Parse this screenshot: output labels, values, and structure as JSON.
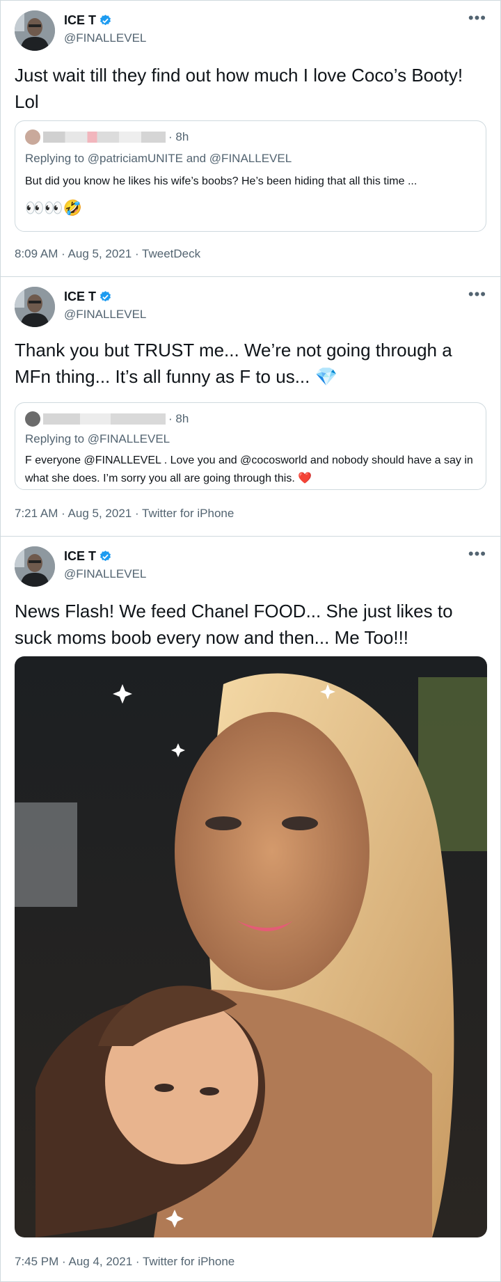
{
  "tweets": [
    {
      "author": "ICE T",
      "handle": "@FINALLEVEL",
      "text": "Just wait till they find out how much I love Coco’s Booty! Lol",
      "quote": {
        "time": "· 8h",
        "replying": "Replying to @patriciamUNITE and @FINALLEVEL",
        "body": "But did you know he likes his wife’s boobs? He’s been hiding that all this time ...",
        "emojis": "👀👀🤣"
      },
      "meta": "8:09 AM · Aug 5, 2021 · TweetDeck"
    },
    {
      "author": "ICE T",
      "handle": "@FINALLEVEL",
      "text": "Thank you but TRUST me... We’re not going through a MFn thing... It’s all funny as F to us... 💎",
      "quote": {
        "time": "· 8h",
        "replying": "Replying to @FINALLEVEL",
        "body": "F everyone @FINALLEVEL . Love you and @cocosworld and nobody should have a say in what she does. I’m sorry you all are going through this. ❤️"
      },
      "meta": "7:21 AM · Aug 5, 2021 · Twitter for iPhone"
    },
    {
      "author": "ICE T",
      "handle": "@FINALLEVEL",
      "text": "News Flash! We feed Chanel FOOD... She just likes to suck moms boob every now and then... Me Too!!!",
      "meta": "7:45 PM · Aug 4, 2021 · Twitter for iPhone"
    }
  ],
  "icons": {
    "more": "more-horizontal-icon",
    "verified": "verified-badge-icon"
  },
  "colors": {
    "verified": "#1d9bf0",
    "secondary_text": "#536471",
    "border": "#cfd9de"
  }
}
